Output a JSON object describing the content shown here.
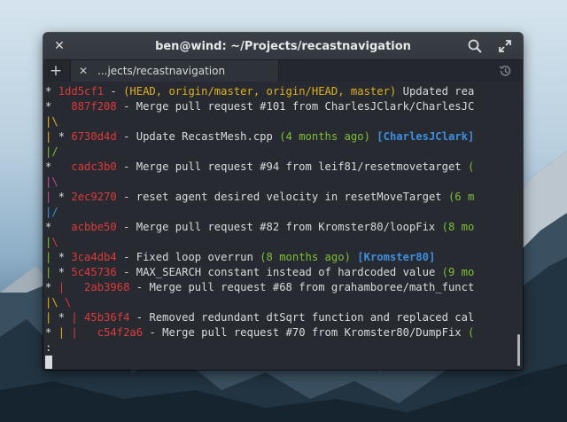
{
  "window": {
    "title": "ben@wind: ~/Projects/recastnavigation"
  },
  "tabs": [
    {
      "label": "...jects/recastnavigation"
    }
  ],
  "terminal": {
    "lines": [
      [
        {
          "t": "* ",
          "c": "gw"
        },
        {
          "t": "1dd5cf1",
          "c": "hash"
        },
        {
          "t": " - ",
          "c": "gw"
        },
        {
          "t": "(HEAD, origin/master, origin/HEAD, master)",
          "c": "ref"
        },
        {
          "t": " Updated rea",
          "c": "gw"
        }
      ],
      [
        {
          "t": "*   ",
          "c": "gw"
        },
        {
          "t": "887f208",
          "c": "hash"
        },
        {
          "t": " - Merge pull request #101 from CharlesJClark/CharlesJC",
          "c": "gw"
        }
      ],
      [
        {
          "t": "|\\",
          "c": "gy"
        }
      ],
      [
        {
          "t": "| ",
          "c": "gy"
        },
        {
          "t": "* ",
          "c": "gw"
        },
        {
          "t": "6730d4d",
          "c": "hash"
        },
        {
          "t": " - Update RecastMesh.cpp ",
          "c": "gw"
        },
        {
          "t": "(4 months ago)",
          "c": "time"
        },
        {
          "t": " ",
          "c": "gw"
        },
        {
          "t": "[CharlesJClark]",
          "c": "auth"
        }
      ],
      [
        {
          "t": "|/",
          "c": "gg"
        }
      ],
      [
        {
          "t": "*   ",
          "c": "gw"
        },
        {
          "t": "cadc3b0",
          "c": "hash"
        },
        {
          "t": " - Merge pull request #94 from leif81/resetmovetarget ",
          "c": "gw"
        },
        {
          "t": "(",
          "c": "time"
        }
      ],
      [
        {
          "t": "|\\",
          "c": "gm"
        }
      ],
      [
        {
          "t": "| ",
          "c": "gm"
        },
        {
          "t": "* ",
          "c": "gw"
        },
        {
          "t": "2ec9270",
          "c": "hash"
        },
        {
          "t": " - reset agent desired velocity in resetMoveTarget ",
          "c": "gw"
        },
        {
          "t": "(6 m",
          "c": "time"
        }
      ],
      [
        {
          "t": "|/",
          "c": "gb"
        }
      ],
      [
        {
          "t": "*   ",
          "c": "gw"
        },
        {
          "t": "acbbe50",
          "c": "hash"
        },
        {
          "t": " - Merge pull request #82 from Kromster80/loopFix ",
          "c": "gw"
        },
        {
          "t": "(8 mo",
          "c": "time"
        }
      ],
      [
        {
          "t": "|",
          "c": "gg"
        },
        {
          "t": "\\",
          "c": "gr"
        }
      ],
      [
        {
          "t": "| ",
          "c": "gg"
        },
        {
          "t": "* ",
          "c": "gw"
        },
        {
          "t": "3ca4db4",
          "c": "hash"
        },
        {
          "t": " - Fixed loop overrun ",
          "c": "gw"
        },
        {
          "t": "(8 months ago)",
          "c": "time"
        },
        {
          "t": " ",
          "c": "gw"
        },
        {
          "t": "[Kromster80]",
          "c": "auth"
        }
      ],
      [
        {
          "t": "| ",
          "c": "gg"
        },
        {
          "t": "* ",
          "c": "gw"
        },
        {
          "t": "5c45736",
          "c": "hash"
        },
        {
          "t": " - MAX_SEARCH constant instead of hardcoded value ",
          "c": "gw"
        },
        {
          "t": "(9 mo",
          "c": "time"
        }
      ],
      [
        {
          "t": "* ",
          "c": "gw"
        },
        {
          "t": "| ",
          "c": "gr"
        },
        {
          "t": "  ",
          "c": "gw"
        },
        {
          "t": "2ab3968",
          "c": "hash"
        },
        {
          "t": " - Merge pull request #68 from grahamboree/math_funct",
          "c": "gw"
        }
      ],
      [
        {
          "t": "|",
          "c": "gy"
        },
        {
          "t": "\\ ",
          "c": "gy"
        },
        {
          "t": "\\",
          "c": "gr"
        }
      ],
      [
        {
          "t": "| ",
          "c": "gy"
        },
        {
          "t": "* ",
          "c": "gw"
        },
        {
          "t": "| ",
          "c": "gr"
        },
        {
          "t": "45b36f4",
          "c": "hash"
        },
        {
          "t": " - Removed redundant dtSqrt function and replaced cal",
          "c": "gw"
        }
      ],
      [
        {
          "t": "* ",
          "c": "gw"
        },
        {
          "t": "| ",
          "c": "gy"
        },
        {
          "t": "|   ",
          "c": "gr"
        },
        {
          "t": "c54f2a6",
          "c": "hash"
        },
        {
          "t": " - Merge pull request #70 from Kromster80/DumpFix ",
          "c": "gw"
        },
        {
          "t": "(",
          "c": "time"
        }
      ],
      [
        {
          "t": ":",
          "c": "gw"
        }
      ]
    ]
  }
}
